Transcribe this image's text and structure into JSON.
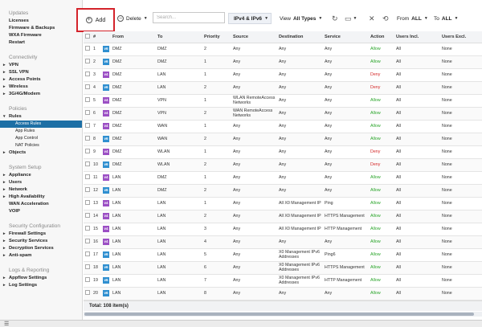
{
  "sidebar": {
    "sections": [
      {
        "title": "",
        "items": [
          {
            "label": "Updates",
            "kind": "title"
          },
          {
            "label": "Licenses",
            "kind": "item"
          },
          {
            "label": "Firmware & Backups",
            "kind": "item"
          },
          {
            "label": "WXA Firmware",
            "kind": "item"
          },
          {
            "label": "Restart",
            "kind": "item"
          }
        ]
      }
    ],
    "items": [
      {
        "label": "Updates",
        "kind": "title"
      },
      {
        "label": "Licenses",
        "kind": "item"
      },
      {
        "label": "Firmware & Backups",
        "kind": "item"
      },
      {
        "label": "WXA Firmware",
        "kind": "item"
      },
      {
        "label": "Restart",
        "kind": "item"
      },
      {
        "label": "",
        "kind": "gap"
      },
      {
        "label": "Connectivity",
        "kind": "title"
      },
      {
        "label": "VPN",
        "kind": "expand"
      },
      {
        "label": "SSL VPN",
        "kind": "expand"
      },
      {
        "label": "Access Points",
        "kind": "expand"
      },
      {
        "label": "Wireless",
        "kind": "expand"
      },
      {
        "label": "3G/4G/Modem",
        "kind": "expand"
      },
      {
        "label": "",
        "kind": "gap"
      },
      {
        "label": "Policies",
        "kind": "title"
      },
      {
        "label": "Rules",
        "kind": "open"
      },
      {
        "label": "Access Rules",
        "kind": "sub-active"
      },
      {
        "label": "App Rules",
        "kind": "sub"
      },
      {
        "label": "App Control",
        "kind": "sub"
      },
      {
        "label": "NAT Policies",
        "kind": "sub"
      },
      {
        "label": "Objects",
        "kind": "expand"
      },
      {
        "label": "",
        "kind": "gap"
      },
      {
        "label": "System Setup",
        "kind": "title"
      },
      {
        "label": "Appliance",
        "kind": "expand"
      },
      {
        "label": "Users",
        "kind": "expand"
      },
      {
        "label": "Network",
        "kind": "expand"
      },
      {
        "label": "High Availability",
        "kind": "expand"
      },
      {
        "label": "WAN Acceleration",
        "kind": "item"
      },
      {
        "label": "VOIP",
        "kind": "item"
      },
      {
        "label": "",
        "kind": "gap"
      },
      {
        "label": "Security Configuration",
        "kind": "title"
      },
      {
        "label": "Firewall Settings",
        "kind": "expand"
      },
      {
        "label": "Security Services",
        "kind": "expand"
      },
      {
        "label": "Decryption Services",
        "kind": "expand"
      },
      {
        "label": "Anti-spam",
        "kind": "expand"
      },
      {
        "label": "",
        "kind": "gap"
      },
      {
        "label": "Logs & Reporting",
        "kind": "title"
      },
      {
        "label": "Appflow Settings",
        "kind": "expand"
      },
      {
        "label": "Log Settings",
        "kind": "expand"
      }
    ]
  },
  "toolbar": {
    "add_label": "Add",
    "delete_label": "Delete",
    "search_placeholder": "Search...",
    "ip_filter": "IPv4 & IPv6",
    "view_label": "View",
    "view_value": "All Types",
    "from_label": "From",
    "from_value": "ALL",
    "to_label": "To",
    "to_value": "ALL"
  },
  "table": {
    "columns": [
      "#",
      "From",
      "To",
      "Priority",
      "Source",
      "Destination",
      "Service",
      "Action",
      "Users Incl.",
      "Users Excl."
    ],
    "rows": [
      {
        "num": "1",
        "ver": "v6",
        "from": "DMZ",
        "to": "DMZ",
        "priority": "2",
        "source": "Any",
        "dest": "Any",
        "service": "Any",
        "action": "Allow",
        "incl": "All",
        "excl": "None"
      },
      {
        "num": "2",
        "ver": "v6",
        "from": "DMZ",
        "to": "DMZ",
        "priority": "1",
        "source": "Any",
        "dest": "Any",
        "service": "Any",
        "action": "Allow",
        "incl": "All",
        "excl": "None"
      },
      {
        "num": "3",
        "ver": "v4",
        "from": "DMZ",
        "to": "LAN",
        "priority": "1",
        "source": "Any",
        "dest": "Any",
        "service": "Any",
        "action": "Deny",
        "incl": "All",
        "excl": "None"
      },
      {
        "num": "4",
        "ver": "v6",
        "from": "DMZ",
        "to": "LAN",
        "priority": "2",
        "source": "Any",
        "dest": "Any",
        "service": "Any",
        "action": "Deny",
        "incl": "All",
        "excl": "None"
      },
      {
        "num": "5",
        "ver": "v4",
        "from": "DMZ",
        "to": "VPN",
        "priority": "1",
        "source": "WLAN RemoteAccess Networks",
        "dest": "Any",
        "service": "Any",
        "action": "Allow",
        "incl": "All",
        "excl": "None"
      },
      {
        "num": "6",
        "ver": "v4",
        "from": "DMZ",
        "to": "VPN",
        "priority": "2",
        "source": "WAN RemoteAccess Networks",
        "dest": "Any",
        "service": "Any",
        "action": "Allow",
        "incl": "All",
        "excl": "None"
      },
      {
        "num": "7",
        "ver": "v4",
        "from": "DMZ",
        "to": "WAN",
        "priority": "1",
        "source": "Any",
        "dest": "Any",
        "service": "Any",
        "action": "Allow",
        "incl": "All",
        "excl": "None"
      },
      {
        "num": "8",
        "ver": "v6",
        "from": "DMZ",
        "to": "WAN",
        "priority": "2",
        "source": "Any",
        "dest": "Any",
        "service": "Any",
        "action": "Allow",
        "incl": "All",
        "excl": "None"
      },
      {
        "num": "9",
        "ver": "v4",
        "from": "DMZ",
        "to": "WLAN",
        "priority": "1",
        "source": "Any",
        "dest": "Any",
        "service": "Any",
        "action": "Deny",
        "incl": "All",
        "excl": "None"
      },
      {
        "num": "10",
        "ver": "v6",
        "from": "DMZ",
        "to": "WLAN",
        "priority": "2",
        "source": "Any",
        "dest": "Any",
        "service": "Any",
        "action": "Deny",
        "incl": "All",
        "excl": "None"
      },
      {
        "num": "11",
        "ver": "v4",
        "from": "LAN",
        "to": "DMZ",
        "priority": "1",
        "source": "Any",
        "dest": "Any",
        "service": "Any",
        "action": "Allow",
        "incl": "All",
        "excl": "None"
      },
      {
        "num": "12",
        "ver": "v6",
        "from": "LAN",
        "to": "DMZ",
        "priority": "2",
        "source": "Any",
        "dest": "Any",
        "service": "Any",
        "action": "Allow",
        "incl": "All",
        "excl": "None"
      },
      {
        "num": "13",
        "ver": "v4",
        "from": "LAN",
        "to": "LAN",
        "priority": "1",
        "source": "Any",
        "dest": "All X0 Management IP",
        "service": "Ping",
        "action": "Allow",
        "incl": "All",
        "excl": "None"
      },
      {
        "num": "14",
        "ver": "v4",
        "from": "LAN",
        "to": "LAN",
        "priority": "2",
        "source": "Any",
        "dest": "All X0 Management IP",
        "service": "HTTPS Management",
        "action": "Allow",
        "incl": "All",
        "excl": "None"
      },
      {
        "num": "15",
        "ver": "v4",
        "from": "LAN",
        "to": "LAN",
        "priority": "3",
        "source": "Any",
        "dest": "All X0 Management IP",
        "service": "HTTP Management",
        "action": "Allow",
        "incl": "All",
        "excl": "None"
      },
      {
        "num": "16",
        "ver": "v4",
        "from": "LAN",
        "to": "LAN",
        "priority": "4",
        "source": "Any",
        "dest": "Any",
        "service": "Any",
        "action": "Allow",
        "incl": "All",
        "excl": "None"
      },
      {
        "num": "17",
        "ver": "v6",
        "from": "LAN",
        "to": "LAN",
        "priority": "5",
        "source": "Any",
        "dest": "X0 Management IPv6 Addresses",
        "service": "Ping6",
        "action": "Allow",
        "incl": "All",
        "excl": "None"
      },
      {
        "num": "18",
        "ver": "v6",
        "from": "LAN",
        "to": "LAN",
        "priority": "6",
        "source": "Any",
        "dest": "X0 Management IPv6 Addresses",
        "service": "HTTPS Management",
        "action": "Allow",
        "incl": "All",
        "excl": "None"
      },
      {
        "num": "19",
        "ver": "v6",
        "from": "LAN",
        "to": "LAN",
        "priority": "7",
        "source": "Any",
        "dest": "X0 Management IPv6 Addresses",
        "service": "HTTP Management",
        "action": "Allow",
        "incl": "All",
        "excl": "None"
      },
      {
        "num": "20",
        "ver": "v6",
        "from": "LAN",
        "to": "LAN",
        "priority": "8",
        "source": "Any",
        "dest": "Any",
        "service": "Any",
        "action": "Allow",
        "incl": "All",
        "excl": "None"
      },
      {
        "num": "21",
        "ver": "v6",
        "from": "LAN",
        "to": "VPN",
        "priority": "1",
        "source": "WLAN RemoteAccess Networks",
        "dest": "Any",
        "service": "Any",
        "action": "Allow",
        "incl": "All",
        "excl": "None"
      }
    ]
  },
  "footer": {
    "total": "Total: 108 item(s)"
  },
  "colors": {
    "v4": "#9b4fc4",
    "v6": "#2f8fd0",
    "allow": "#2aa52a",
    "deny": "#d42828",
    "active_nav": "#1d6fa5",
    "highlight_box": "#d4232b"
  },
  "icons": [
    "add-circle-icon",
    "delete-circle-icon",
    "ip-version-icon",
    "refresh-icon",
    "monitor-icon",
    "close-icon",
    "history-icon",
    "hamburger-icon"
  ]
}
